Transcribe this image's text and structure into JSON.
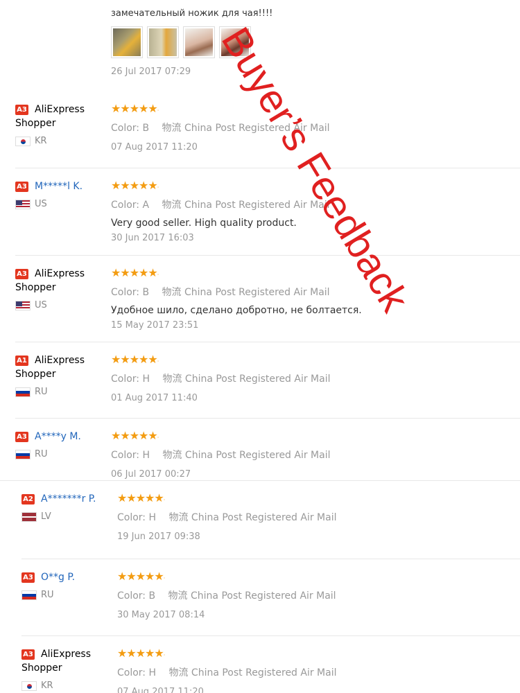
{
  "top_review": {
    "text": "замечательный ножик для чая!!!!",
    "date": "26 Jul 2017 07:29"
  },
  "stars": "★★★★★",
  "color_label": "Color:",
  "shipping_label": "物流",
  "upper_feedback": [
    {
      "level": "A3",
      "name_line1": "AliExpress",
      "name_line2": "Shopper",
      "country": "KR",
      "color": "B",
      "shipping": "China Post Registered Air Mail",
      "comment": "",
      "date": "07 Aug 2017 11:20"
    },
    {
      "level": "A3",
      "name_line1": "M*****l K.",
      "name_line2": "",
      "country": "US",
      "color": "A",
      "shipping": "China Post Registered Air Mail",
      "comment": "Very good seller. High quality product.",
      "date": "30 Jun 2017 16:03"
    },
    {
      "level": "A3",
      "name_line1": "AliExpress",
      "name_line2": "Shopper",
      "country": "US",
      "color": "B",
      "shipping": "China Post Registered Air Mail",
      "comment": "Удобное шило, сделано добротно, не болтается.",
      "date": "15 May 2017 23:51"
    },
    {
      "level": "A1",
      "name_line1": "AliExpress",
      "name_line2": "Shopper",
      "country": "RU",
      "color": "H",
      "shipping": "China Post Registered Air Mail",
      "comment": "",
      "date": "01 Aug 2017 11:40"
    },
    {
      "level": "A3",
      "name_line1": "A****y M.",
      "name_line2": "",
      "country": "RU",
      "color": "H",
      "shipping": "China Post Registered Air Mail",
      "comment": "",
      "date": "06 Jul 2017 00:27"
    }
  ],
  "lower_feedback": [
    {
      "level": "A2",
      "name_line1": "A*******r P.",
      "name_line2": "",
      "country": "LV",
      "color": "H",
      "shipping": "China Post Registered Air Mail",
      "comment": "",
      "date": "19 Jun 2017 09:38"
    },
    {
      "level": "A3",
      "name_line1": "O**g P.",
      "name_line2": "",
      "country": "RU",
      "color": "B",
      "shipping": "China Post Registered Air Mail",
      "comment": "",
      "date": "30 May 2017 08:14"
    },
    {
      "level": "A3",
      "name_line1": "AliExpress",
      "name_line2": "Shopper",
      "country": "KR",
      "color": "H",
      "shipping": "China Post Registered Air Mail",
      "comment": "",
      "date": "07 Aug 2017 11:20"
    }
  ],
  "watermark": "Buyer’s Feedback"
}
